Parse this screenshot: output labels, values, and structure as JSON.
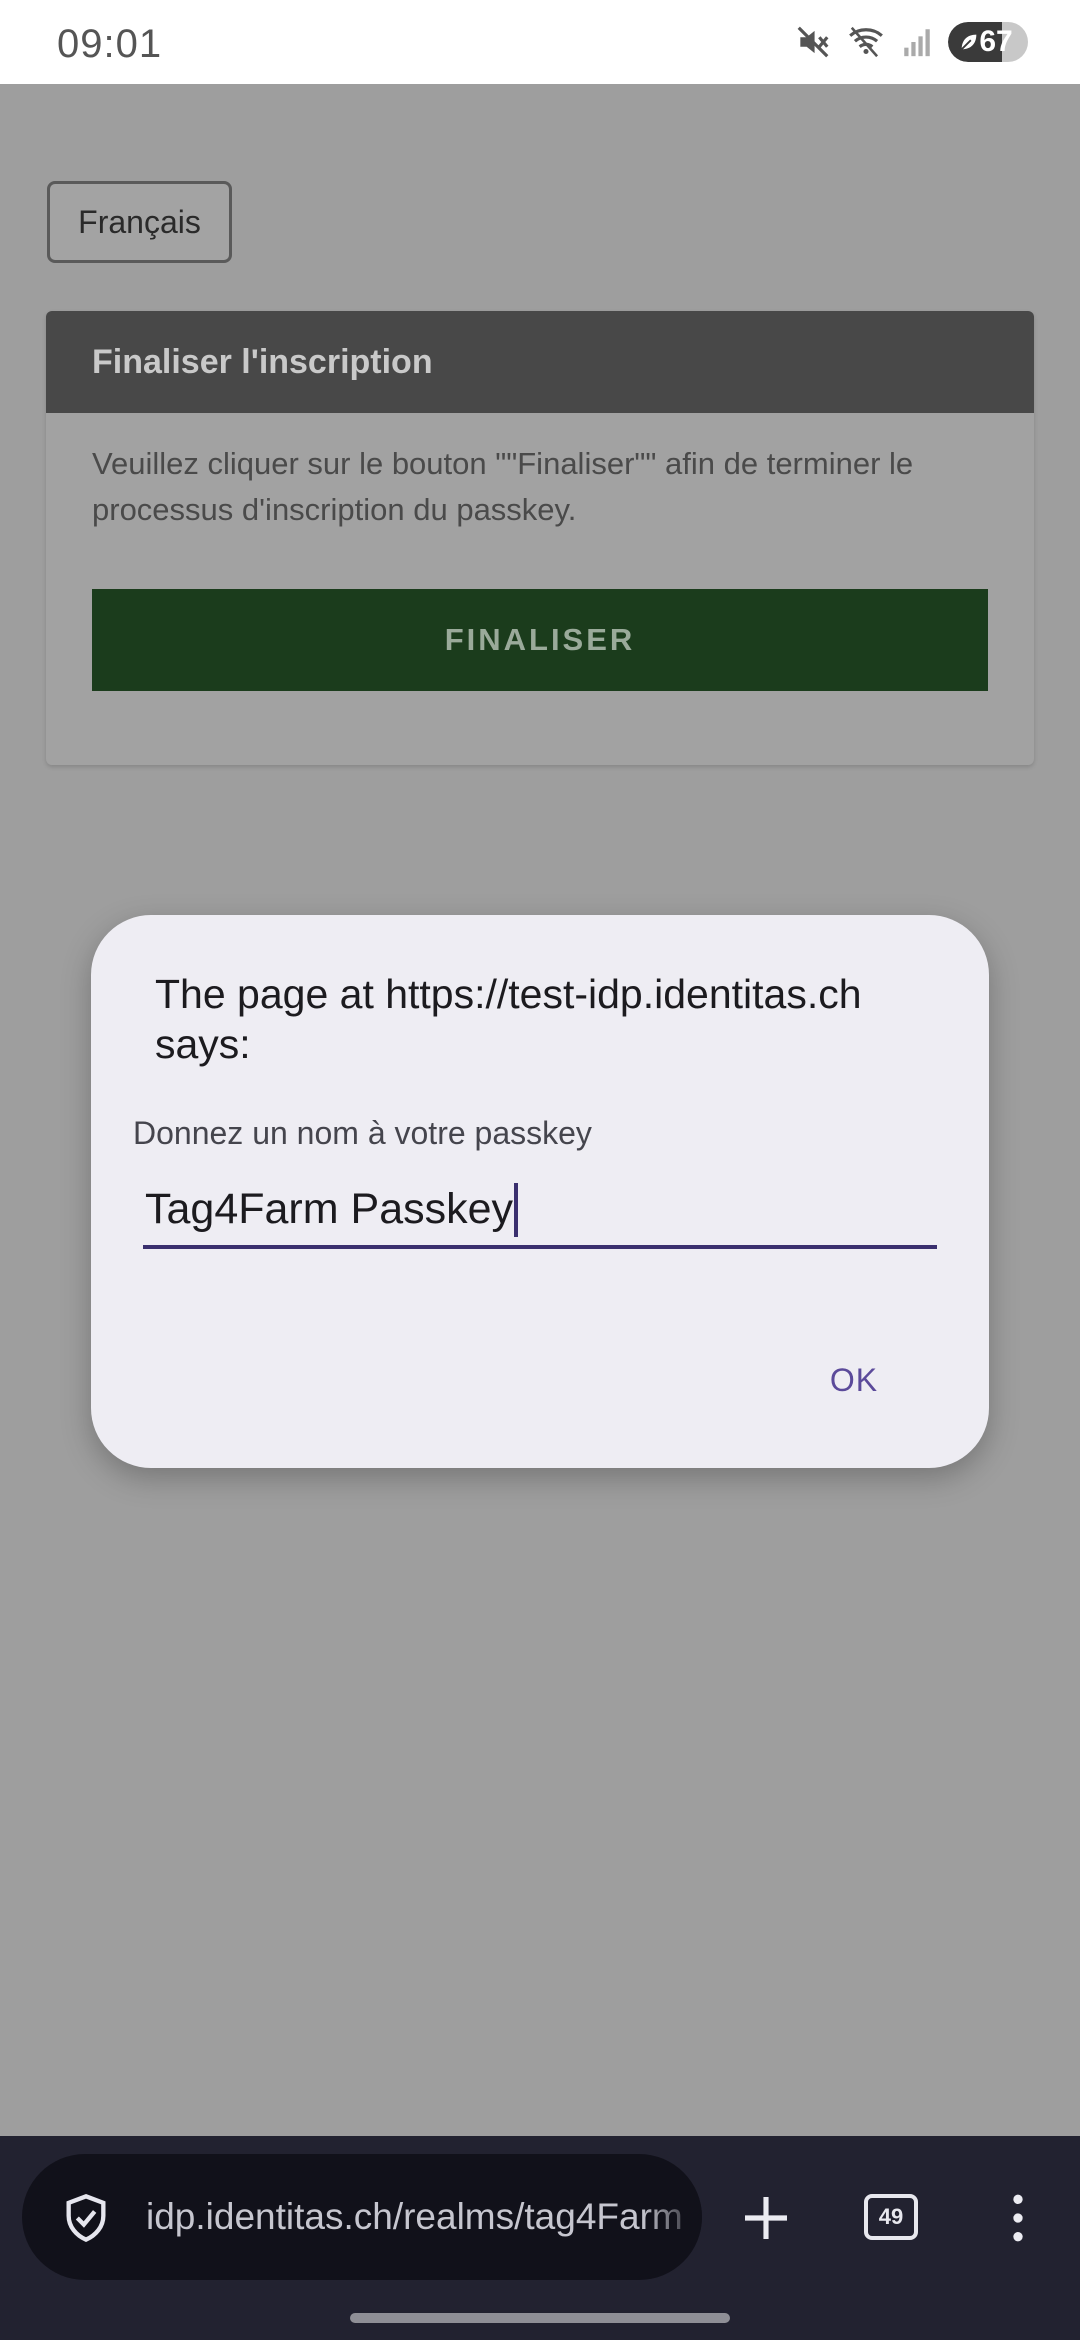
{
  "status_bar": {
    "time": "09:01",
    "battery_level": "67",
    "icons": [
      "mute-icon",
      "wifi-icon",
      "signal-icon",
      "battery-icon"
    ]
  },
  "page": {
    "language_button": "Français",
    "card": {
      "title": "Finaliser l'inscription",
      "body": "Veuillez cliquer sur le bouton \"\"Finaliser\"\" afin de terminer le processus d'inscription du passkey.",
      "finalize_button": "FINALISER"
    }
  },
  "dialog": {
    "title": "The page at https://test-idp.identitas.ch says:",
    "message": "Donnez un nom à votre passkey",
    "input_value": "Tag4Farm Passkey",
    "ok_label": "OK"
  },
  "browser": {
    "url": "idp.identitas.ch/realms/tag4Farm",
    "tab_count": "49"
  },
  "colors": {
    "finalize_bg": "#1b3c1c",
    "card_header_bg": "#484848",
    "dialog_bg": "#eeedf3",
    "accent": "#5b4a9a"
  }
}
